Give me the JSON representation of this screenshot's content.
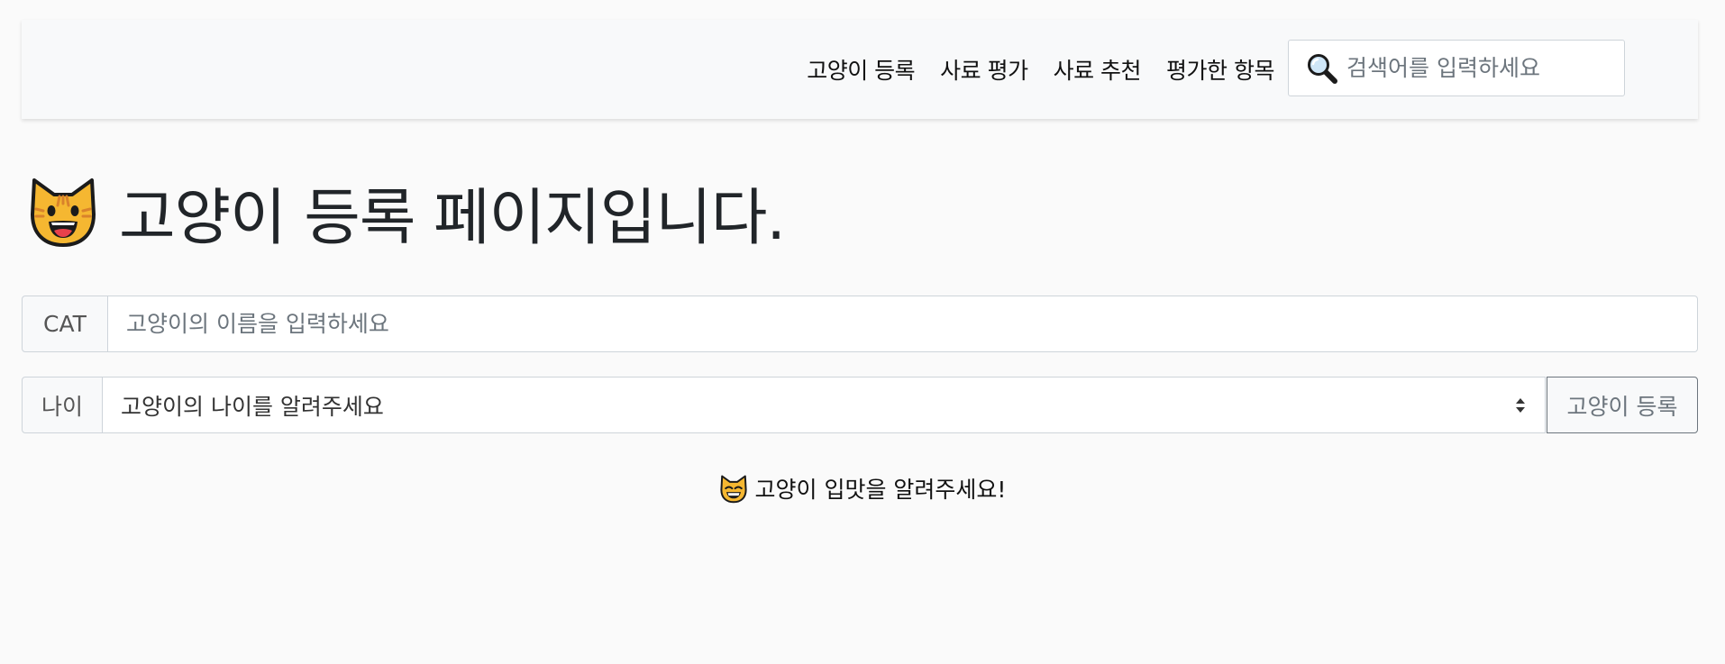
{
  "navbar": {
    "links": [
      "고양이 등록",
      "사료 평가",
      "사료 추천",
      "평가한 항목"
    ],
    "search": {
      "placeholder": "검색어를 입력하세요",
      "icon": "magnifier-icon"
    }
  },
  "main": {
    "title": "고양이 등록 페이지입니다.",
    "title_icon": "cat-face-icon",
    "name_group": {
      "label": "CAT",
      "placeholder": "고양이의 이름을 입력하세요"
    },
    "age_group": {
      "label": "나이",
      "selected": "고양이의 나이를 알려주세요",
      "button": "고양이 등록"
    },
    "taste_prompt": "고양이 입맛을 알려주세요!",
    "taste_icon": "grinning-cat-icon"
  },
  "colors": {
    "background": "#fafafa",
    "navbar": "#f8f9fa",
    "border": "#ced4da",
    "placeholder": "#6c757d",
    "cat_yellow": "#f5b731"
  }
}
